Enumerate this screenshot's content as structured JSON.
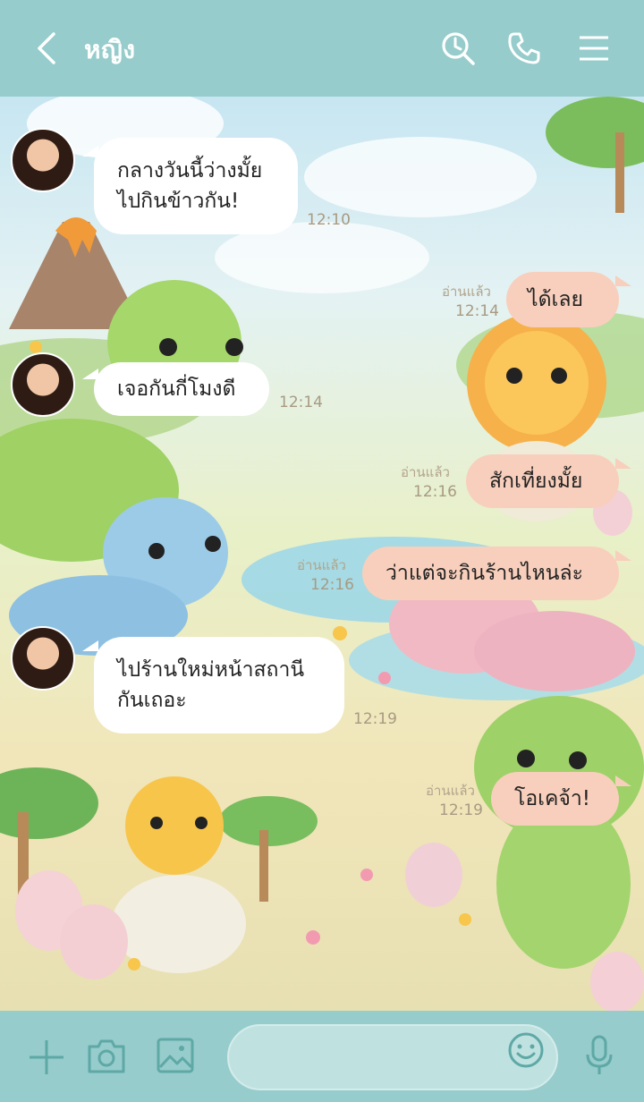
{
  "header": {
    "contact_name": "หญิง",
    "icons": [
      "back-chevron",
      "search",
      "phone",
      "menu"
    ]
  },
  "messages": [
    {
      "side": "in",
      "text": "กลางวันนี้ว่างมั้ย\nไปกินข้าวกัน!",
      "time": "12:10"
    },
    {
      "side": "out",
      "text": "ได้เลย",
      "read": "อ่านแล้ว",
      "time": "12:14"
    },
    {
      "side": "in",
      "text": "เจอกันกี่โมงดี",
      "time": "12:14"
    },
    {
      "side": "out",
      "text": "สักเที่ยงมั้ย",
      "read": "อ่านแล้ว",
      "time": "12:16"
    },
    {
      "side": "out",
      "text": "ว่าแต่จะกินร้านไหนล่ะ",
      "read": "อ่านแล้ว",
      "time": "12:16"
    },
    {
      "side": "in",
      "text": "ไปร้านใหม่หน้าสถานี\nกันเถอะ",
      "time": "12:19"
    },
    {
      "side": "out",
      "text": "โอเคจ้า!",
      "read": "อ่านแล้ว",
      "time": "12:19"
    }
  ],
  "composer": {
    "placeholder": "",
    "icons": [
      "plus",
      "camera",
      "image",
      "emoji",
      "microphone"
    ]
  },
  "colors": {
    "header_bg": "#96cccb",
    "incoming_bubble": "#ffffff",
    "outgoing_bubble": "#f8cfbc",
    "icon": "#ffffff",
    "bottom_icon": "#5ea8a6"
  }
}
